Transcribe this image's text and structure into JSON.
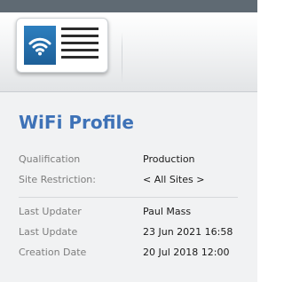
{
  "header": {
    "icon": "wifi-profile-icon"
  },
  "page": {
    "title": "WiFi Profile"
  },
  "details": [
    {
      "label": "Qualification",
      "value": "Production"
    },
    {
      "label": "Site Restriction:",
      "value": "< All Sites >"
    }
  ],
  "audit": [
    {
      "label": "Last Updater",
      "value": "Paul Mass"
    },
    {
      "label": "Last Update",
      "value": "23 Jun 2021 16:58"
    },
    {
      "label": "Creation Date",
      "value": "20 Jul 2018 12:00"
    }
  ],
  "colors": {
    "title": "#3e72b7",
    "icon_blue": "#2574b3",
    "label": "#7d7d7d",
    "value": "#1a1a1a"
  }
}
